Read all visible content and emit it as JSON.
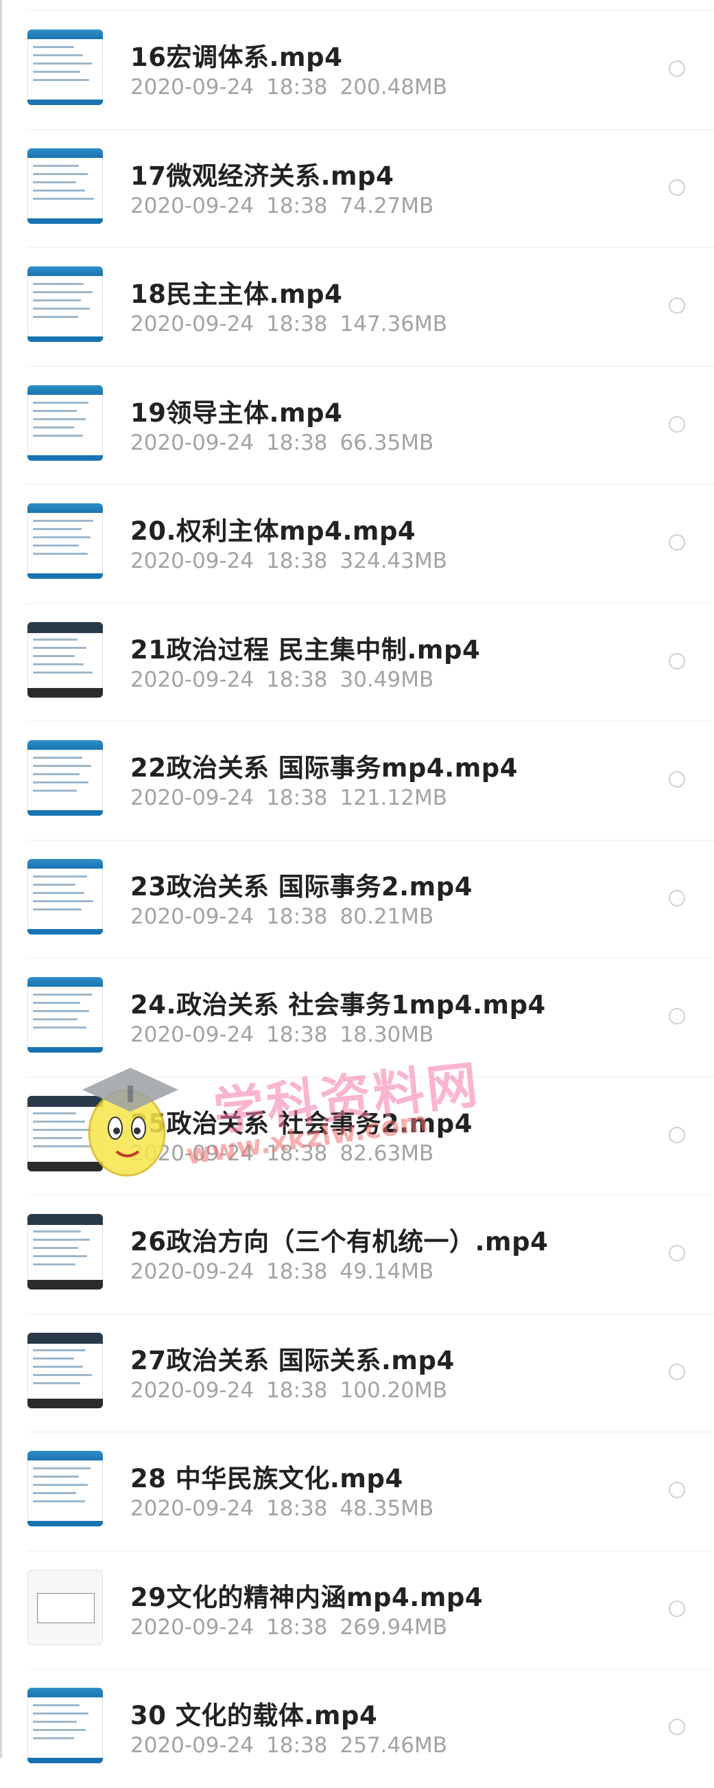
{
  "files": [
    {
      "name": "16宏调体系.mp4",
      "date": "2020-09-24",
      "time": "18:38",
      "size": "200.48MB",
      "thumb": "blue"
    },
    {
      "name": "17微观经济关系.mp4",
      "date": "2020-09-24",
      "time": "18:38",
      "size": "74.27MB",
      "thumb": "blue"
    },
    {
      "name": "18民主主体.mp4",
      "date": "2020-09-24",
      "time": "18:38",
      "size": "147.36MB",
      "thumb": "blue"
    },
    {
      "name": "19领导主体.mp4",
      "date": "2020-09-24",
      "time": "18:38",
      "size": "66.35MB",
      "thumb": "blue"
    },
    {
      "name": "20.权利主体mp4.mp4",
      "date": "2020-09-24",
      "time": "18:38",
      "size": "324.43MB",
      "thumb": "blue"
    },
    {
      "name": "21政治过程 民主集中制.mp4",
      "date": "2020-09-24",
      "time": "18:38",
      "size": "30.49MB",
      "thumb": "dark"
    },
    {
      "name": "22政治关系 国际事务mp4.mp4",
      "date": "2020-09-24",
      "time": "18:38",
      "size": "121.12MB",
      "thumb": "blue"
    },
    {
      "name": "23政治关系 国际事务2.mp4",
      "date": "2020-09-24",
      "time": "18:38",
      "size": "80.21MB",
      "thumb": "blue"
    },
    {
      "name": "24.政治关系 社会事务1mp4.mp4",
      "date": "2020-09-24",
      "time": "18:38",
      "size": "18.30MB",
      "thumb": "blue"
    },
    {
      "name": "25政治关系 社会事务2.mp4",
      "date": "2020-09-24",
      "time": "18:38",
      "size": "82.63MB",
      "thumb": "dark"
    },
    {
      "name": "26政治方向（三个有机统一）.mp4",
      "date": "2020-09-24",
      "time": "18:38",
      "size": "49.14MB",
      "thumb": "dark"
    },
    {
      "name": "27政治关系 国际关系.mp4",
      "date": "2020-09-24",
      "time": "18:38",
      "size": "100.20MB",
      "thumb": "dark"
    },
    {
      "name": "28 中华民族文化.mp4",
      "date": "2020-09-24",
      "time": "18:38",
      "size": "48.35MB",
      "thumb": "blue"
    },
    {
      "name": "29文化的精神内涵mp4.mp4",
      "date": "2020-09-24",
      "time": "18:38",
      "size": "269.94MB",
      "thumb": "plain"
    },
    {
      "name": "30 文化的载体.mp4",
      "date": "2020-09-24",
      "time": "18:38",
      "size": "257.46MB",
      "thumb": "blue"
    }
  ],
  "watermark": {
    "text": "学科资料网",
    "url": "www.xkzlw.com"
  }
}
